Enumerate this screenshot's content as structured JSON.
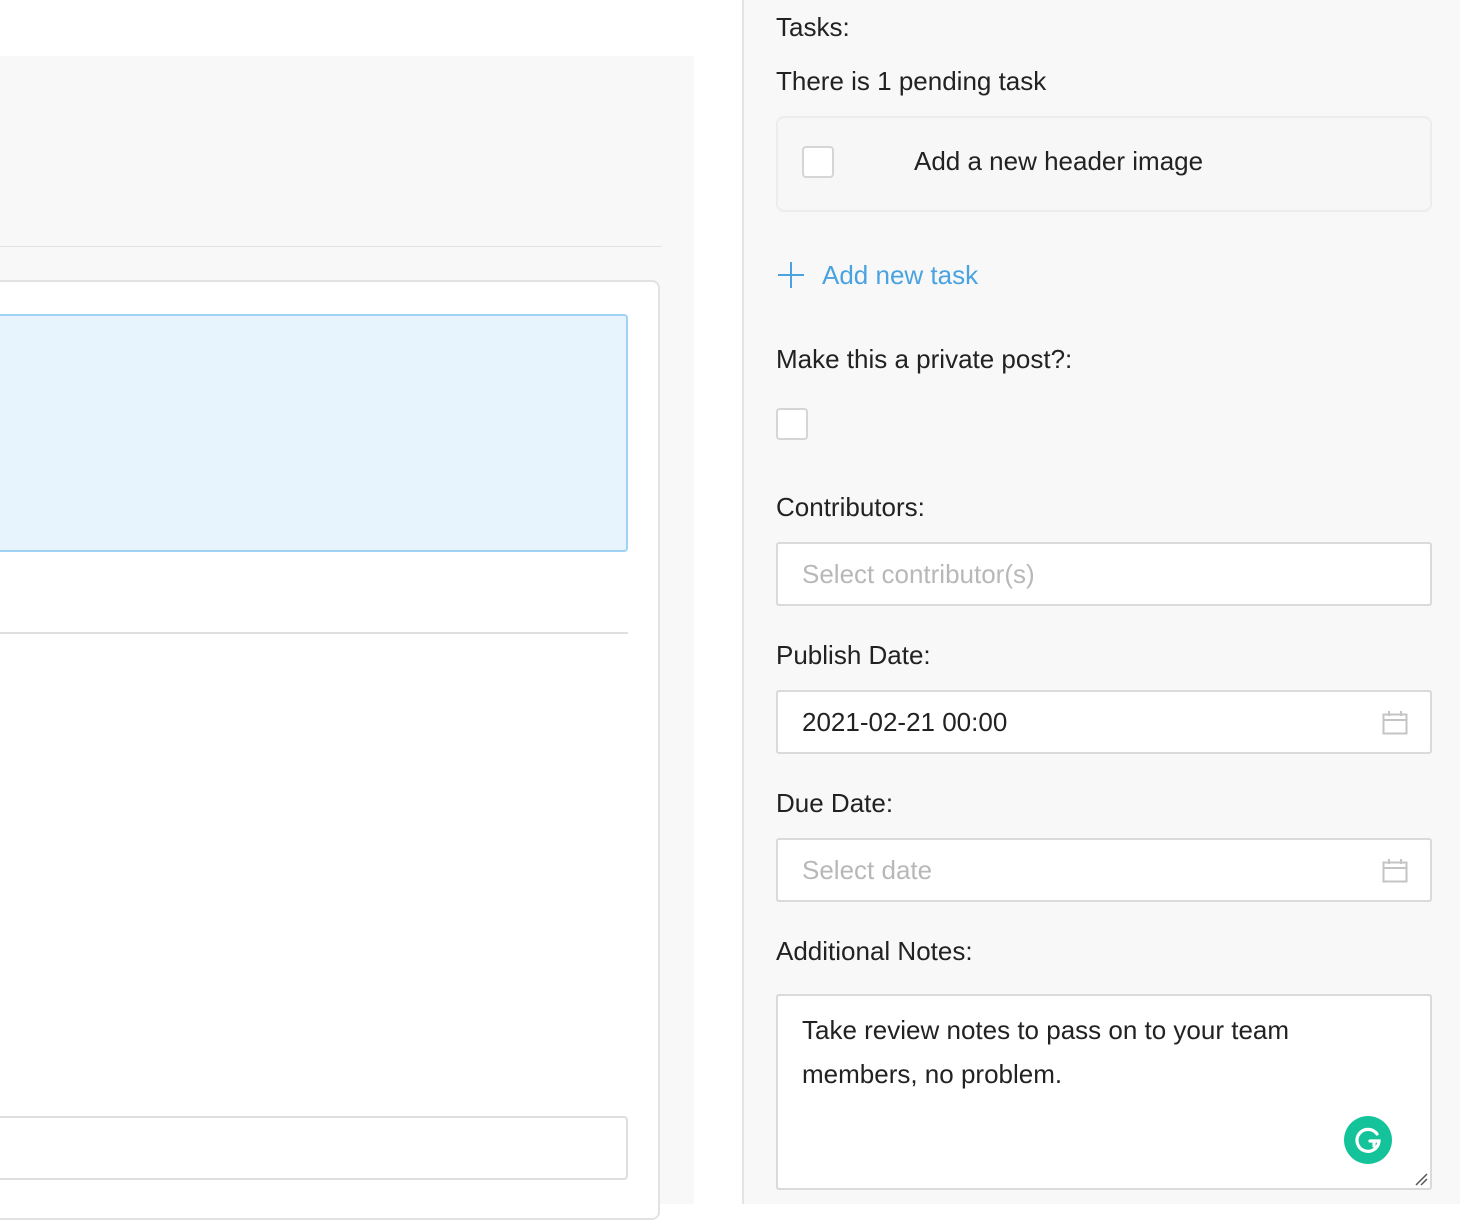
{
  "sidebar": {
    "tasks": {
      "label": "Tasks:",
      "summary": "There is 1 pending task",
      "items": [
        {
          "text": "Add a new header image",
          "checked": false
        }
      ],
      "add_label": "Add new task"
    },
    "private_post": {
      "label": "Make this a private post?",
      "colon": ":",
      "checked": false
    },
    "contributors": {
      "label": "Contributors",
      "colon": ":",
      "placeholder": "Select contributor(s)"
    },
    "publish_date": {
      "label": "Publish Date",
      "colon": ":",
      "value": "2021-02-21 00:00"
    },
    "due_date": {
      "label": "Due Date",
      "colon": ":",
      "placeholder": "Select date"
    },
    "notes": {
      "label": "Additional Notes",
      "colon": ":",
      "value": "Take review notes to pass on to your team members, no problem."
    }
  },
  "colors": {
    "accent": "#4aa3e0",
    "grammarly": "#15c39a",
    "highlight": "#e8f4fd"
  },
  "icons": [
    "plus-icon",
    "calendar-icon",
    "grammarly-icon",
    "resize-handle-icon"
  ]
}
